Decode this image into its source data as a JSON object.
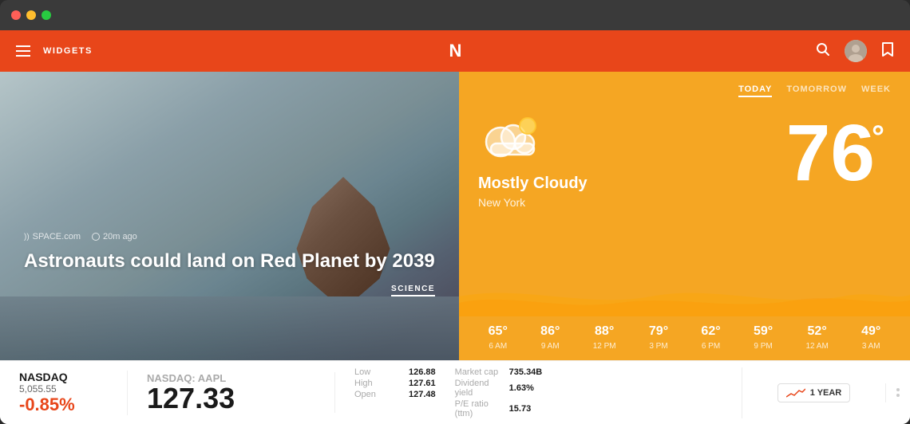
{
  "titlebar": {
    "btn_red": "red",
    "btn_yellow": "yellow",
    "btn_green": "green"
  },
  "navbar": {
    "widgets_label": "WIDGETS",
    "logo": "N",
    "search_icon": "search",
    "bookmark_icon": "bookmark"
  },
  "hero": {
    "source_name": "SPACE.com",
    "time_ago": "20m ago",
    "title": "Astronauts could land on Red Planet by 2039",
    "tag": "SCIENCE"
  },
  "weather": {
    "tabs": [
      "TODAY",
      "TOMORROW",
      "WEEK"
    ],
    "active_tab": "TODAY",
    "condition": "Mostly Cloudy",
    "city": "New York",
    "temperature": "76",
    "degree_symbol": "°",
    "hourly": [
      {
        "temp": "65°",
        "time": "6 AM"
      },
      {
        "temp": "86°",
        "time": "9 AM"
      },
      {
        "temp": "88°",
        "time": "12 PM"
      },
      {
        "temp": "79°",
        "time": "3 PM"
      },
      {
        "temp": "62°",
        "time": "6 PM"
      },
      {
        "temp": "59°",
        "time": "9 PM"
      },
      {
        "temp": "52°",
        "time": "12 AM"
      },
      {
        "temp": "49°",
        "time": "3 AM"
      }
    ]
  },
  "ticker": {
    "nasdaq_name": "NASDAQ",
    "nasdaq_value": "5,055.55",
    "nasdaq_change": "-0.85%",
    "aapl_label": "NASDAQ: AAPL",
    "aapl_price": "127.33",
    "stats": {
      "low_label": "Low",
      "low_value": "126.88",
      "high_label": "High",
      "high_value": "127.61",
      "open_label": "Open",
      "open_value": "127.48",
      "market_cap_label": "Market cap",
      "market_cap_value": "735.34B",
      "dividend_label": "Dividend yield",
      "dividend_value": "1.63%",
      "pe_label": "P/E ratio (ttm)",
      "pe_value": "15.73"
    },
    "chart_btn": "1 YEAR"
  }
}
